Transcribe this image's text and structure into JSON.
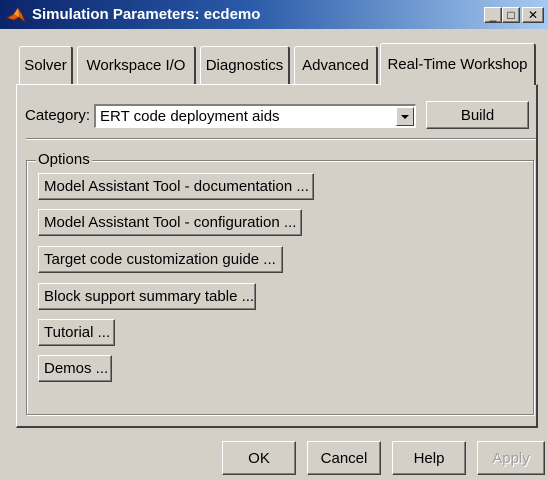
{
  "window": {
    "title": "Simulation Parameters: ecdemo",
    "minimize_glyph": "_",
    "maximize_glyph": "□",
    "close_glyph": "✕"
  },
  "tabs": [
    {
      "label": "Solver"
    },
    {
      "label": "Workspace I/O"
    },
    {
      "label": "Diagnostics"
    },
    {
      "label": "Advanced"
    },
    {
      "label": "Real-Time Workshop",
      "active": true
    }
  ],
  "category": {
    "label": "Category:",
    "selected": "ERT code deployment aids"
  },
  "build_label": "Build",
  "options": {
    "title": "Options",
    "buttons": [
      "Model Assistant Tool - documentation ...",
      "Model Assistant Tool - configuration ...",
      "Target code customization guide ...",
      "Block support summary table ...",
      "Tutorial ...",
      "Demos ..."
    ]
  },
  "footer": {
    "ok": "OK",
    "cancel": "Cancel",
    "help": "Help",
    "apply": "Apply"
  },
  "colors": {
    "titlebar_start": "#0a246a",
    "titlebar_end": "#a6caf0",
    "face": "#d4d0c8"
  }
}
